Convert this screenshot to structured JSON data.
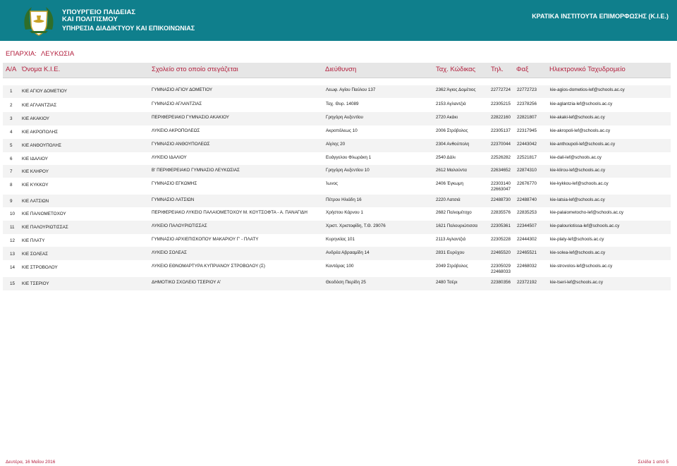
{
  "header": {
    "ministry_line1": "ΥΠΟΥΡΓΕΙΟ ΠΑΙΔΕΙΑΣ",
    "ministry_line2": "ΚΑΙ ΠΟΛΙΤΙΣΜΟΥ",
    "service": "ΥΠΗΡΕΣΙΑ ΔΙΑΔΙΚΤΥΟΥ ΚΑΙ ΕΠΙΚΟΙΝΩΝΙΑΣ",
    "institutes": "ΚΡΑΤΙΚΑ ΙΝΣΤΙΤΟΥΤΑ ΕΠΙΜΟΡΦΩΣΗΣ (Κ.Ι.Ε.)",
    "logo_icon": "coat-of-arms-icon"
  },
  "district": {
    "label": "ΕΠΑΡΧΙΑ:",
    "value": "ΛΕΥΚΩΣΙΑ"
  },
  "columns": {
    "aa": "Α/Α",
    "name": "Όνομα Κ.Ι.Ε.",
    "school": "Σχολείο στο οποίο στεγάζεται",
    "address": "Διεύθυνση",
    "postal": "Ταχ. Κώδικας",
    "phone": "Τηλ.",
    "fax": "Φαξ",
    "email": "Ηλεκτρονικό Ταχυδρομείο"
  },
  "rows": [
    {
      "aa": "1",
      "name": "ΚΙΕ ΑΓΙΟΥ ΔΟΜΕΤΙΟΥ",
      "school": "ΓΥΜΝΑΣΙΟ ΑΓΙΟΥ ΔΟΜΕΤΙΟΥ",
      "address": "Λεωφ. Αγίου Παύλου 137",
      "postal": "2362 Άγιος Δομέτιος",
      "phone": "22772724",
      "phone2": "",
      "fax": "22772723",
      "email": "kie-agios-dometios-lef@schools.ac.cy"
    },
    {
      "aa": "2",
      "name": "ΚΙΕ ΑΓΛΑΝΤΖΙΑΣ",
      "school": "ΓΥΜΝΑΣΙΟ ΑΓΛΑΝΤΖΙΑΣ",
      "address": "Ταχ. Θυρ. 14089",
      "postal": "2153 Αγλαντζιά",
      "phone": "22305215",
      "phone2": "",
      "fax": "22378256",
      "email": "kie-aglantzia-lef@schools.ac.cy"
    },
    {
      "aa": "3",
      "name": "ΚΙΕ ΑΚΑΚΙΟΥ",
      "school": "ΠΕΡΙΦΕΡΕΙΑΚΟ ΓΥΜΝΑΣΙΟ ΑΚΑΚΙΟΥ",
      "address": "Γρηγόρη Αυξεντίου",
      "postal": "2720 Ακάκι",
      "phone": "22822160",
      "phone2": "",
      "fax": "22821807",
      "email": "kie-akaki-lef@schools.ac.cy"
    },
    {
      "aa": "4",
      "name": "ΚΙΕ ΑΚΡΟΠΟΛΗΣ",
      "school": "ΛΥΚΕΙΟ ΑΚΡΟΠΟΛΕΩΣ",
      "address": "Ακροπόλεως 10",
      "postal": "2006 Στρόβολος",
      "phone": "22305137",
      "phone2": "",
      "fax": "22317945",
      "email": "kie-akropoli-lef@schools.ac.cy"
    },
    {
      "aa": "5",
      "name": "ΚΙΕ ΑΝΘΟΥΠΟΛΗΣ",
      "school": "ΓΥΜΝΑΣΙΟ ΑΝΘΟΥΠΟΛΕΩΣ",
      "address": "Αίγλης 20",
      "postal": "2304 Ανθούπολη",
      "phone": "22370044",
      "phone2": "",
      "fax": "22443042",
      "email": "kie-anthoupoli-lef@schools.ac.cy"
    },
    {
      "aa": "6",
      "name": "ΚΙΕ ΙΔΑΛΙΟΥ",
      "school": "ΛΥΚΕΙΟ ΙΔΑΛΙΟΥ",
      "address": "Ευάγγελου Φλωράκη 1",
      "postal": "2540 Δάλι",
      "phone": "22526282",
      "phone2": "",
      "fax": "22521817",
      "email": "kie-dali-lef@schools.ac.cy"
    },
    {
      "aa": "7",
      "name": "ΚΙΕ ΚΛΗΡΟΥ",
      "school": "Β' ΠΕΡΙΦΕΡΕΙΑΚΟ ΓΥΜΝΑΣΙΟ ΛΕΥΚΩΣΙΑΣ",
      "address": "Γρηγόρη Αυξεντίου 10",
      "postal": "2612 Μαλούντα",
      "phone": "22634652",
      "phone2": "",
      "fax": "22874310",
      "email": "kie-klirou-lef@schools.ac.cy"
    },
    {
      "aa": "8",
      "name": "ΚΙΕ ΚΥΚΚΟΥ",
      "school": "ΓΥΜΝΑΣΙΟ ΕΓΚΩΜΗΣ",
      "address": "Ίωνος",
      "postal": "2406 Έγκωμη",
      "phone": "22303140",
      "phone2": "22663047",
      "fax": "22676770",
      "email": "kie-kykkou-lef@schools.ac.cy"
    },
    {
      "aa": "9",
      "name": "ΚΙΕ ΛΑΤΣΙΩΝ",
      "school": "ΓΥΜΝΑΣΙΟ ΛΑΤΣΙΩΝ",
      "address": "Πέτρου Ηλιάδη 16",
      "postal": "2220 Λατσιά",
      "phone": "22488730",
      "phone2": "",
      "fax": "22488740",
      "email": "kie-latsia-lef@schools.ac.cy"
    },
    {
      "aa": "10",
      "name": "ΚΙΕ ΠΑΛΙΟΜΕΤΟΧΟΥ",
      "school": "ΠΕΡΙΦΕΡΕΙΑΚΟ ΛΥΚΕΙΟ ΠΑΛΑΙΟΜΕΤΟΧΟΥ Μ. ΚΟΥΤΣΟΦΤΑ - Α. ΠΑΝΑΓΙΔΗ",
      "address": "Χρήστου Κάρνου 1",
      "postal": "2682 Παλιομέτοχο",
      "phone": "22835576",
      "phone2": "",
      "fax": "22835253",
      "email": "kie-palaiometocho-lef@schools.ac.cy"
    },
    {
      "aa": "11",
      "name": "ΚΙΕ ΠΑΛΟΥΡΙΩΤΙΣΣΑΣ",
      "school": "ΛΥΚΕΙΟ ΠΑΛΟΥΡΙΩΤΙΣΣΑΣ",
      "address": "Χριστ. Χριστοφίδη, Τ.Θ. 29076",
      "postal": "1621 Παλουριώτισσα",
      "phone": "22305361",
      "phone2": "",
      "fax": "22344507",
      "email": "kie-palouriotissa-lef@schools.ac.cy"
    },
    {
      "aa": "12",
      "name": "ΚΙΕ ΠΛΑΤΥ",
      "school": "ΓΥΜΝΑΣΙΟ ΑΡΧΙΕΠΙΣΚΟΠΟΥ ΜΑΚΑΡΙΟΥ Γ' - ΠΛΑΤΥ",
      "address": "Κυρηνείας 101",
      "postal": "2113 Αγλαντζιά",
      "phone": "22305228",
      "phone2": "",
      "fax": "22444302",
      "email": "kie-platy-lef@schools.ac.cy"
    },
    {
      "aa": "13",
      "name": "ΚΙΕ ΣΟΛΕΑΣ",
      "school": "ΛΥΚΕΙΟ ΣΟΛΕΑΣ",
      "address": "Ανδρέα Αβρααμίδη 14",
      "postal": "2831 Ευρύχου",
      "phone": "22465520",
      "phone2": "",
      "fax": "22465521",
      "email": "kie-solea-lef@schools.ac.cy"
    },
    {
      "aa": "14",
      "name": "ΚΙΕ ΣΤΡΟΒΟΛΟΥ",
      "school": "ΛΥΚΕΙΟ ΕΘΝΟΜΑΡΤΥΡΑ ΚΥΠΡΙΑΝΟΥ ΣΤΡΟΒΟΛΟΥ (Σ)",
      "address": "Καντάρας 100",
      "postal": "2049 Στρόβολος",
      "phone": "22305029",
      "phone2": "22468033",
      "fax": "22468032",
      "email": "kie-strovolos-lef@schools.ac.cy"
    },
    {
      "aa": "15",
      "name": "ΚΙΕ ΤΣΕΡΙΟΥ",
      "school": "ΔΗΜΟΤΙΚΟ ΣΧΟΛΕΙΟ ΤΣΕΡΙΟΥ Α'",
      "address": "Θεοδόση Πιερίδη 25",
      "postal": "2480 Τσέρι",
      "phone": "22380356",
      "phone2": "",
      "fax": "22372192",
      "email": "kie-tseri-lef@schools.ac.cy"
    }
  ],
  "footer": {
    "date": "Δευτέρα, 16 Μαΐου 2016",
    "page": "Σελίδα 1 από 5"
  }
}
